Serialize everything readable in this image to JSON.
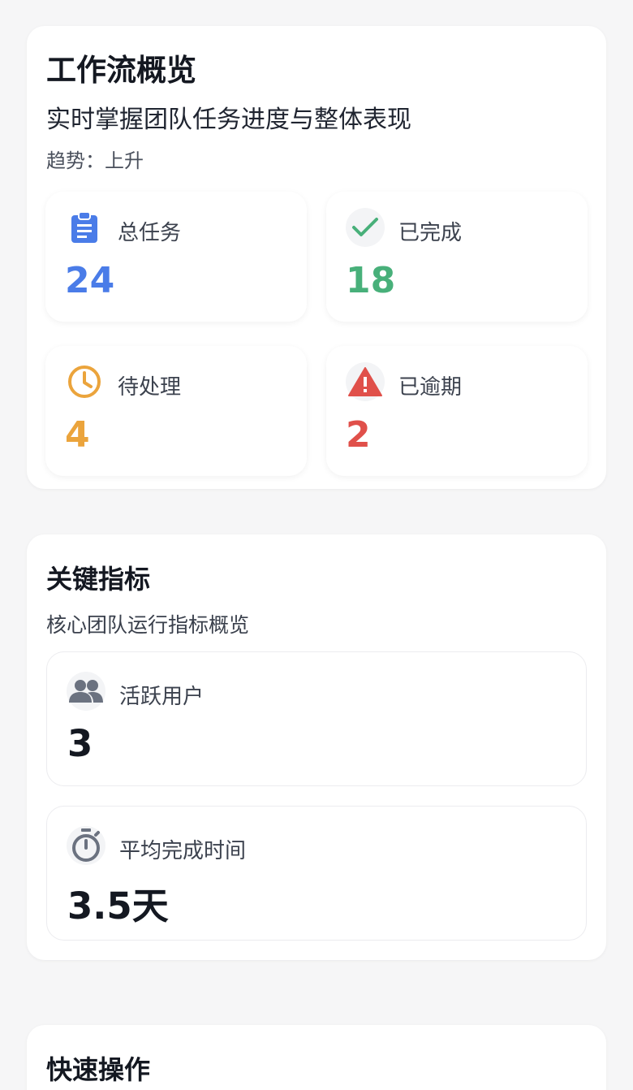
{
  "overview": {
    "title": "工作流概览",
    "subtitle": "实时掌握团队任务进度与整体表现",
    "trend": "趋势：上升",
    "stats": [
      {
        "label": "总任务",
        "value": "24",
        "icon": "clipboard-icon",
        "color": "#4a7ce8"
      },
      {
        "label": "已完成",
        "value": "18",
        "icon": "check-icon",
        "color": "#48b07a"
      },
      {
        "label": "待处理",
        "value": "4",
        "icon": "clock-icon",
        "color": "#eba43c"
      },
      {
        "label": "已逾期",
        "value": "2",
        "icon": "warning-icon",
        "color": "#e0504a"
      }
    ]
  },
  "metrics": {
    "title": "关键指标",
    "subtitle": "核心团队运行指标概览",
    "items": [
      {
        "label": "活跃用户",
        "value": "3",
        "icon": "people-icon"
      },
      {
        "label": "平均完成时间",
        "value": "3.5天",
        "icon": "stopwatch-icon"
      }
    ]
  },
  "actions": {
    "title": "快速操作"
  }
}
